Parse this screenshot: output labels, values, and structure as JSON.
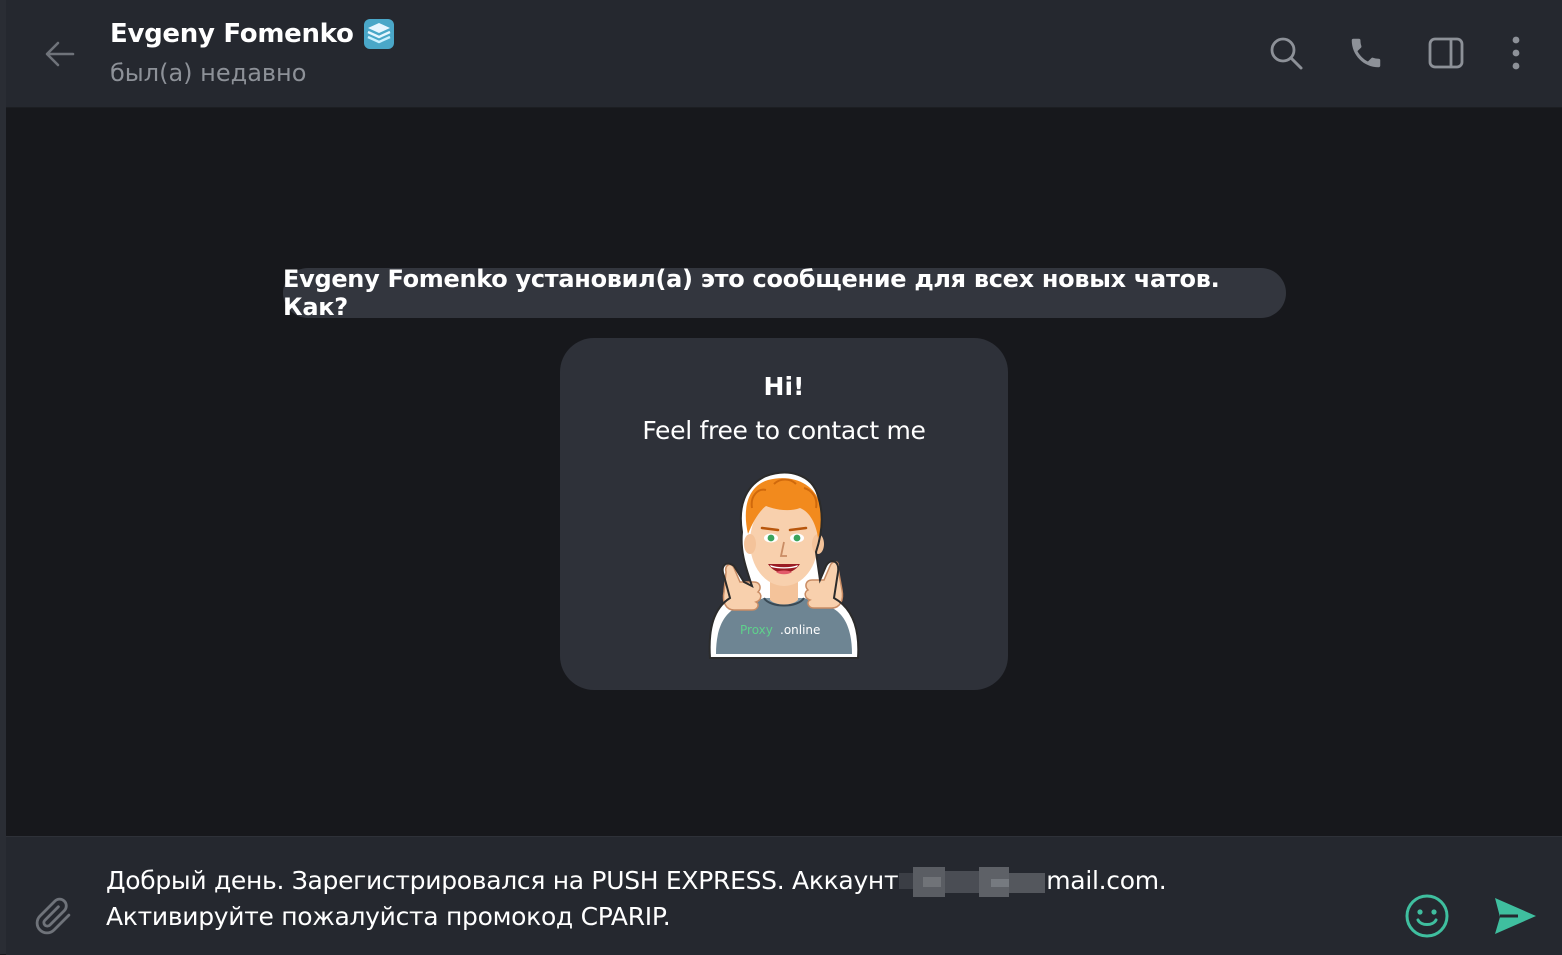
{
  "header": {
    "chat_name": "Evgeny Fomenko",
    "status": "был(а) недавно",
    "icons": {
      "back": "arrow-left-icon",
      "badge": "premium-badge-icon",
      "search": "search-icon",
      "call": "phone-icon",
      "sidebar": "sidebar-toggle-icon",
      "more": "more-vertical-icon"
    }
  },
  "messages": {
    "service_message": "Evgeny Fomenko установил(а) это сообщение для всех новых чатов. Как?",
    "greeting": {
      "title": "Hi!",
      "text": "Feel free to contact me",
      "sticker_label": "Proxy.online"
    }
  },
  "composer": {
    "text_before": "Добрый день. Зарегистрировался на PUSH EXPRESS. Аккаунт",
    "text_after": "mail.com. Активируйте пожалуйста промокод CPARIP.",
    "icons": {
      "attach": "paperclip-icon",
      "emoji": "emoji-icon",
      "send": "send-icon"
    }
  },
  "colors": {
    "header_bg": "#25282f",
    "chat_bg": "#17181c",
    "bubble_bg": "#2e3139",
    "accent": "#3fbf9f",
    "muted": "#8d9198"
  }
}
